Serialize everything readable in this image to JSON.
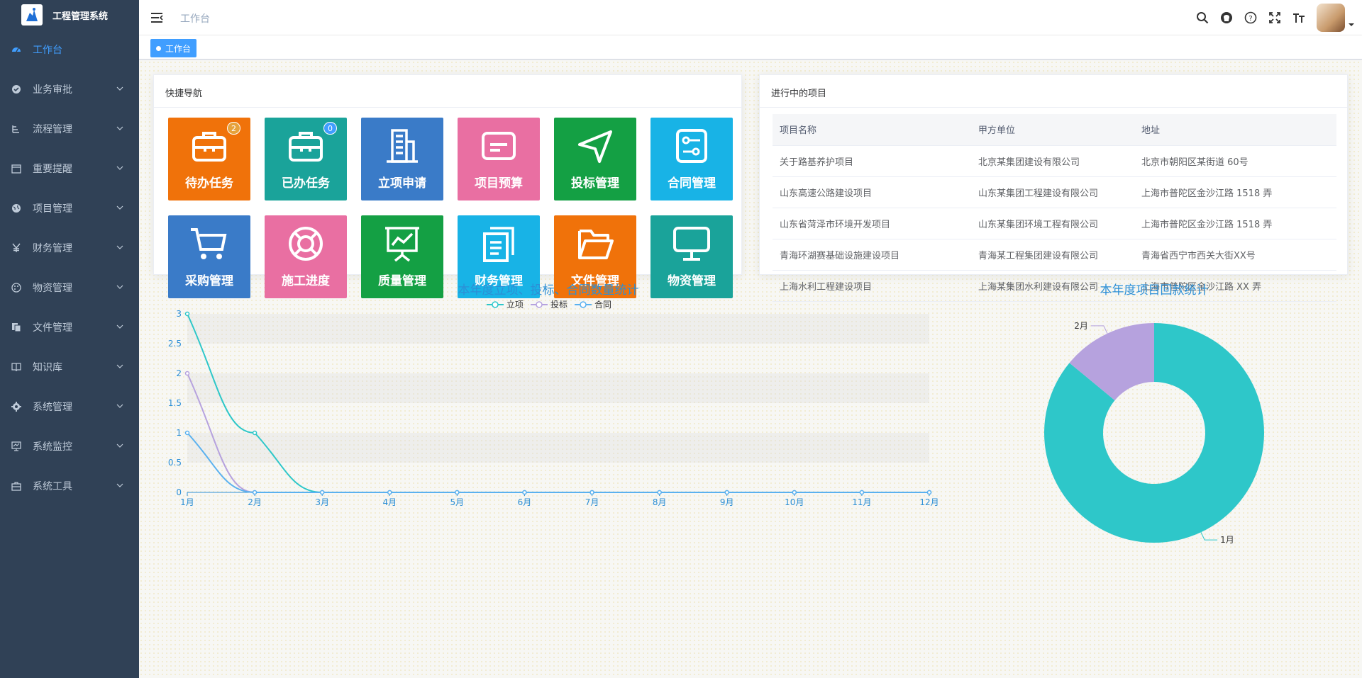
{
  "app": {
    "title": "工程管理系统"
  },
  "sidebar": {
    "items": [
      {
        "label": "工作台",
        "icon": "dashboard-icon",
        "active": true,
        "expandable": false
      },
      {
        "label": "业务审批",
        "icon": "approval-icon",
        "active": false,
        "expandable": true
      },
      {
        "label": "流程管理",
        "icon": "flow-icon",
        "active": false,
        "expandable": true
      },
      {
        "label": "重要提醒",
        "icon": "calendar-icon",
        "active": false,
        "expandable": true
      },
      {
        "label": "项目管理",
        "icon": "globe-icon",
        "active": false,
        "expandable": true
      },
      {
        "label": "财务管理",
        "icon": "yen-icon",
        "active": false,
        "expandable": true
      },
      {
        "label": "物资管理",
        "icon": "palette-icon",
        "active": false,
        "expandable": true
      },
      {
        "label": "文件管理",
        "icon": "file-icon",
        "active": false,
        "expandable": true
      },
      {
        "label": "知识库",
        "icon": "book-icon",
        "active": false,
        "expandable": true
      },
      {
        "label": "系统管理",
        "icon": "gear-icon",
        "active": false,
        "expandable": true
      },
      {
        "label": "系统监控",
        "icon": "monitor-icon",
        "active": false,
        "expandable": true
      },
      {
        "label": "系统工具",
        "icon": "toolbox-icon",
        "active": false,
        "expandable": true
      }
    ]
  },
  "navbar": {
    "breadcrumb": "工作台",
    "icons": [
      "search-icon",
      "github-icon",
      "question-icon",
      "fullscreen-icon",
      "font-size-icon"
    ]
  },
  "tags": {
    "active": "工作台"
  },
  "shortcuts": {
    "title": "快捷导航",
    "tiles": [
      {
        "label": "待办任务",
        "icon": "briefcase-icon",
        "color": "#f0720a",
        "badge": "2",
        "badge_color": "#e6a23c"
      },
      {
        "label": "已办任务",
        "icon": "briefcase-icon",
        "color": "#1aa39a",
        "badge": "0",
        "badge_color": "#409eff"
      },
      {
        "label": "立项申请",
        "icon": "building-icon",
        "color": "#3a7bc8",
        "badge": null
      },
      {
        "label": "项目预算",
        "icon": "card-icon",
        "color": "#e96fa2",
        "badge": null
      },
      {
        "label": "投标管理",
        "icon": "send-icon",
        "color": "#14a044",
        "badge": null
      },
      {
        "label": "合同管理",
        "icon": "contract-icon",
        "color": "#18b3e6",
        "badge": null
      },
      {
        "label": "采购管理",
        "icon": "cart-icon",
        "color": "#3a7bc8",
        "badge": null
      },
      {
        "label": "施工进度",
        "icon": "lifebuoy-icon",
        "color": "#e96fa2",
        "badge": null
      },
      {
        "label": "质量管理",
        "icon": "presentation-icon",
        "color": "#14a044",
        "badge": null
      },
      {
        "label": "财务管理",
        "icon": "copy-icon",
        "color": "#18b3e6",
        "badge": null
      },
      {
        "label": "文件管理",
        "icon": "folder-icon",
        "color": "#f0720a",
        "badge": null
      },
      {
        "label": "物资管理",
        "icon": "monitor-icon",
        "color": "#1aa39a",
        "badge": null
      }
    ]
  },
  "projects": {
    "title": "进行中的项目",
    "columns": [
      "项目名称",
      "甲方单位",
      "地址"
    ],
    "rows": [
      [
        "关于路基养护项目",
        "北京某集团建设有限公司",
        "北京市朝阳区某街道 60号"
      ],
      [
        "山东高速公路建设项目",
        "山东某集团工程建设有限公司",
        "上海市普陀区金沙江路 1518 弄"
      ],
      [
        "山东省菏泽市环境开发项目",
        "山东某集团环境工程有限公司",
        "上海市普陀区金沙江路 1518 弄"
      ],
      [
        "青海环湖赛基础设施建设项目",
        "青海某工程集团建设有限公司",
        "青海省西宁市西关大街XX号"
      ],
      [
        "上海水利工程建设项目",
        "上海某集团水利建设有限公司",
        "上海市普陀区金沙江路 XX 弄"
      ]
    ]
  },
  "chart_data": [
    {
      "type": "line",
      "title": "本年度立项、投标、合同数量统计",
      "categories": [
        "1月",
        "2月",
        "3月",
        "4月",
        "5月",
        "6月",
        "7月",
        "8月",
        "9月",
        "10月",
        "11月",
        "12月"
      ],
      "series": [
        {
          "name": "立项",
          "values": [
            3,
            1,
            0,
            0,
            0,
            0,
            0,
            0,
            0,
            0,
            0,
            0
          ],
          "color": "#2ec7c9"
        },
        {
          "name": "投标",
          "values": [
            2,
            0,
            0,
            0,
            0,
            0,
            0,
            0,
            0,
            0,
            0,
            0
          ],
          "color": "#b6a2de"
        },
        {
          "name": "合同",
          "values": [
            1,
            0,
            0,
            0,
            0,
            0,
            0,
            0,
            0,
            0,
            0,
            0
          ],
          "color": "#5ab1ef"
        }
      ],
      "yticks": [
        "0",
        "0.5",
        "1",
        "1.5",
        "2",
        "2.5",
        "3"
      ],
      "ylim": [
        0,
        3
      ],
      "smooth": true,
      "legend": "top-center",
      "split_area": true
    },
    {
      "type": "pie",
      "title": "本年度项目回款统计",
      "donut": true,
      "slices": [
        {
          "label": "1月",
          "value": 0.86,
          "color": "#2ec7c9"
        },
        {
          "label": "2月",
          "value": 0.14,
          "color": "#b6a2de"
        }
      ]
    }
  ]
}
